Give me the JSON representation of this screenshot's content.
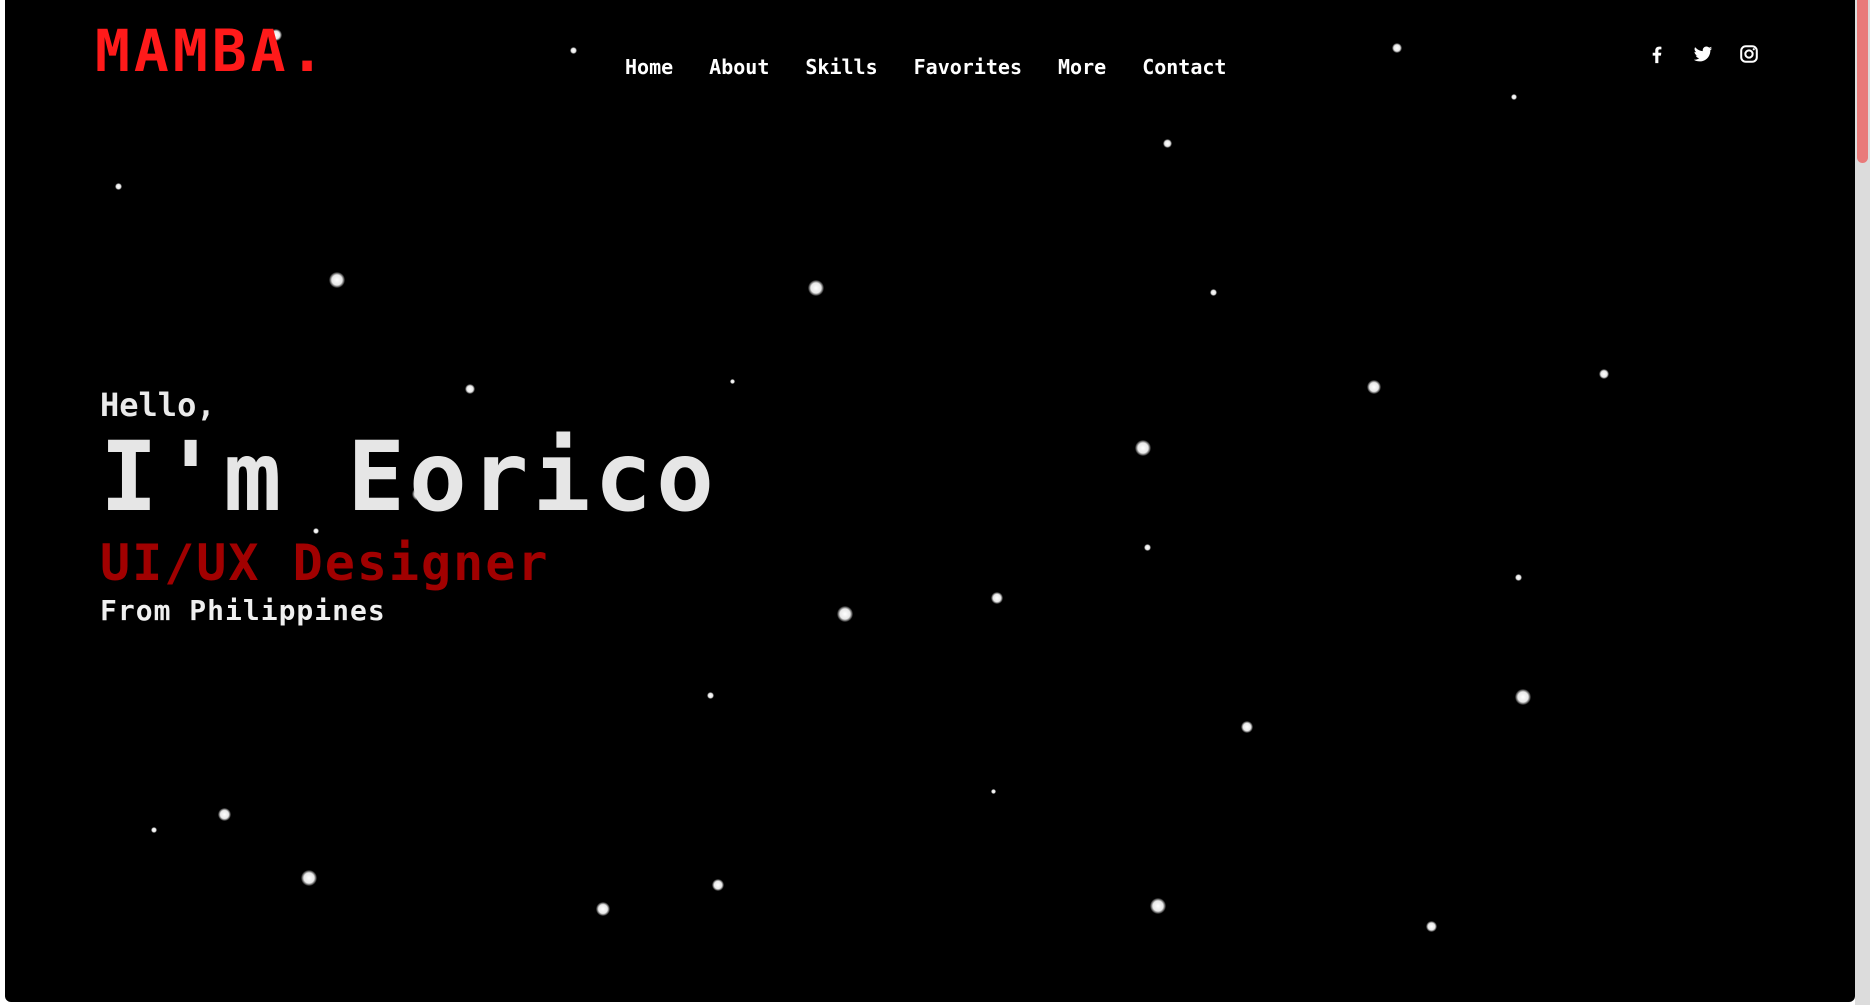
{
  "brand": {
    "logo": "MAMBA."
  },
  "nav": {
    "items": [
      {
        "label": "Home"
      },
      {
        "label": "About"
      },
      {
        "label": "Skills"
      },
      {
        "label": "Favorites"
      },
      {
        "label": "More"
      },
      {
        "label": "Contact"
      }
    ]
  },
  "socials": [
    "facebook-icon",
    "twitter-icon",
    "instagram-icon"
  ],
  "hero": {
    "greeting": "Hello,",
    "name": "I'm Eorico",
    "role": "UI/UX Designer",
    "origin": "From Philippines"
  },
  "colors": {
    "background": "#000000",
    "accent": "#ff1a1a",
    "role": "#a10000",
    "text": "#e6e6e6",
    "scroll_thumb": "#e97a7a"
  }
}
